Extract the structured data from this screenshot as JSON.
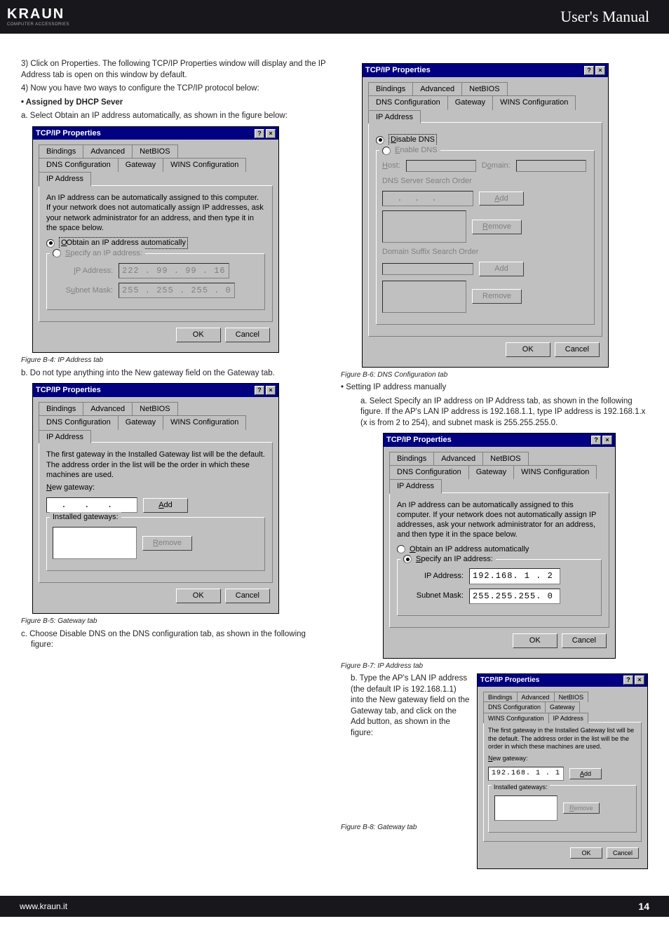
{
  "header": {
    "brand": "KRAUN",
    "brand_sub": "COMPUTER ACCESSORIES",
    "title": "User's Manual"
  },
  "left": {
    "step3": "3) Click on Properties. The following TCP/IP Properties window will display and the IP Address tab is open on this window by default.",
    "step4": "4) Now you have two ways to configure the TCP/IP protocol below:",
    "dhcp_heading": "Assigned by DHCP Sever",
    "step_a": "a. Select Obtain an IP address automatically, as shown in the figure below:",
    "fig_b4_caption": "Figure B-4: IP Address tab",
    "step_b": "b. Do not type anything into the New gateway field on the Gateway tab.",
    "fig_b5_caption": "Figure B-5: Gateway tab",
    "step_c": "c. Choose Disable DNS on the DNS configuration tab, as shown in the following figure:"
  },
  "right": {
    "fig_b6_caption": "Figure B-6: DNS Configuration tab",
    "manual_heading": "Setting IP address manually",
    "manual_a": "a. Select Specify an IP address on IP Address tab, as shown in the following figure. If the AP's LAN IP address is 192.168.1.1, type IP address is 192.168.1.x (x is from 2 to 254), and subnet mask is 255.255.255.0.",
    "fig_b7_caption": "Figure B-7: IP Address tab",
    "manual_b": "b. Type the AP's LAN IP address (the default IP is 192.168.1.1) into the New gateway field on the Gateway tab, and click on the Add button, as shown in the figure:",
    "fig_b8_caption": "Figure B-8: Gateway tab"
  },
  "win": {
    "title": "TCP/IP Properties",
    "tabs": {
      "bindings": "Bindings",
      "advanced": "Advanced",
      "netbios": "NetBIOS",
      "dnsconf": "DNS Configuration",
      "gateway": "Gateway",
      "winsconf": "WINS Configuration",
      "ipaddr": "IP Address"
    },
    "ip_hint": "An IP address can be automatically assigned to this computer. If your network does not automatically assign IP addresses, ask your network administrator for an address, and then type it in the space below.",
    "gw_hint": "The first gateway in the Installed Gateway list will be the default. The address order in the list will be the order in which these machines are used.",
    "radio_obtain_html": "Obtain an IP address automatically",
    "radio_specify_html": "Specify an IP address:",
    "lbl_ipaddr": "IP Address:",
    "lbl_subnet": "Subnet Mask:",
    "lbl_newgw_html": "New gateway:",
    "grp_installed": "Installed gateways:",
    "btn_add_html": "Add",
    "btn_remove_html": "Remove",
    "btn_ok": "OK",
    "btn_cancel": "Cancel",
    "radio_disable_dns_html": "Disable DNS",
    "radio_enable_dns_html": "Enable DNS",
    "lbl_host_html": "Host:",
    "lbl_domain_html": "Domain:",
    "grp_dns_order": "DNS Server Search Order",
    "grp_suffix_order": "Domain Suffix Search Order",
    "val_ip_disabled": "222 . 99 . 99 . 16",
    "val_mask_disabled": "255 . 255 . 255 .  0",
    "val_ip_manual": "192.168. 1 . 2",
    "val_mask_manual": "255.255.255. 0",
    "val_gw_manual": "192.168. 1 . 1",
    "obtain_underline": "O",
    "specify_underline": "S",
    "ipaddr_underline": "I",
    "subnet_underline": "u",
    "newgw_underline": "N",
    "add_underline": "A",
    "remove_underline": "R",
    "disable_underline": "D",
    "enable_underline": "E",
    "host_underline": "H",
    "domain_underline": "o"
  },
  "footer": {
    "url": "www.kraun.it",
    "page": "14"
  }
}
